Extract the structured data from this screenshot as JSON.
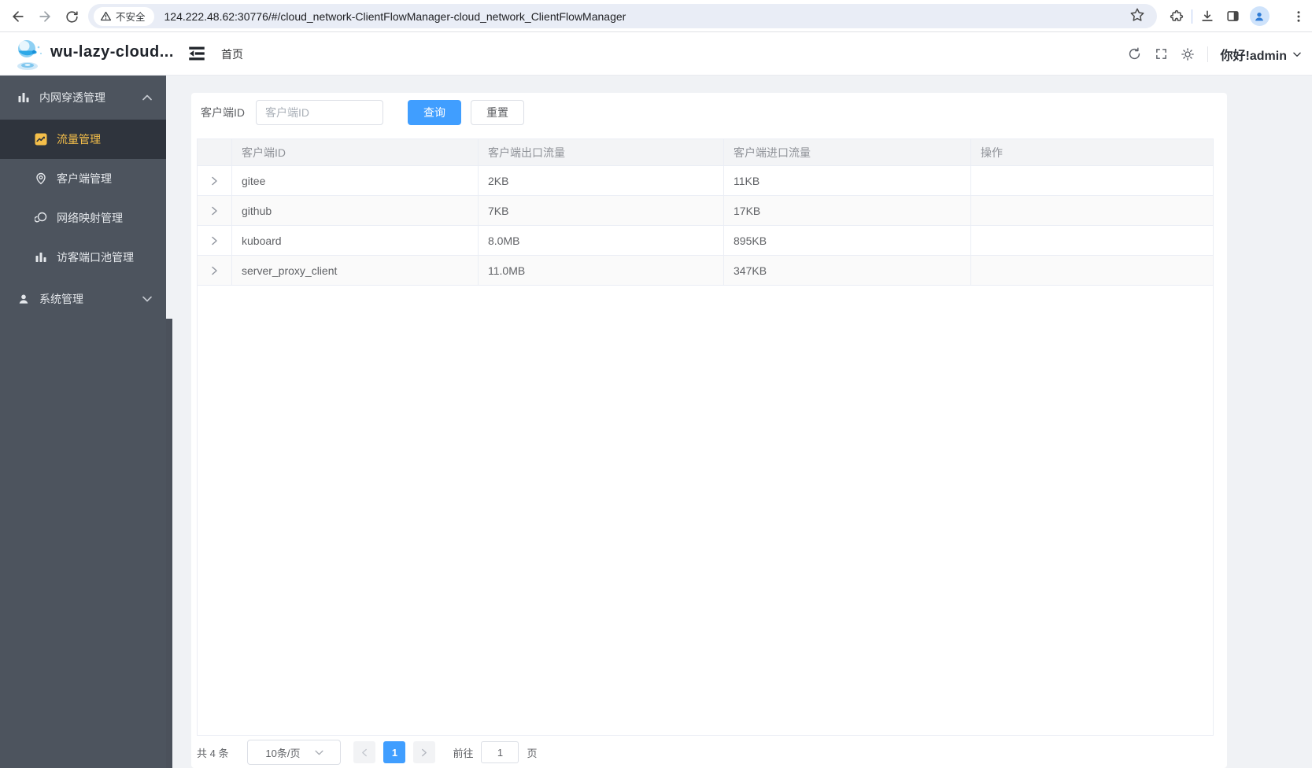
{
  "browser": {
    "security_label": "不安全",
    "url": "124.222.48.62:30776/#/cloud_network-ClientFlowManager-cloud_network_ClientFlowManager"
  },
  "header": {
    "app_title": "wu-lazy-cloud...",
    "nav_home": "首页",
    "greeting": "你好!admin"
  },
  "sidebar": {
    "items": [
      {
        "label": "内网穿透管理",
        "icon": "bar-chart-icon",
        "type": "group",
        "state": "expanded"
      },
      {
        "label": "流量管理",
        "icon": "trend-chart-icon",
        "type": "item",
        "active": true
      },
      {
        "label": "客户端管理",
        "icon": "location-pin-icon",
        "type": "item",
        "active": false
      },
      {
        "label": "网络映射管理",
        "icon": "network-mapping-icon",
        "type": "item",
        "active": false
      },
      {
        "label": "访客端口池管理",
        "icon": "bar-chart-icon",
        "type": "item",
        "active": false
      },
      {
        "label": "系统管理",
        "icon": "user-icon",
        "type": "group",
        "state": "collapsed"
      }
    ]
  },
  "filter": {
    "label": "客户端ID",
    "placeholder": "客户端ID",
    "query_label": "查询",
    "reset_label": "重置"
  },
  "table": {
    "columns": [
      "客户端ID",
      "客户端出口流量",
      "客户端进口流量",
      "操作"
    ],
    "rows": [
      {
        "id": "gitee",
        "out": "2KB",
        "in": "11KB"
      },
      {
        "id": "github",
        "out": "7KB",
        "in": "17KB"
      },
      {
        "id": "kuboard",
        "out": "8.0MB",
        "in": "895KB"
      },
      {
        "id": "server_proxy_client",
        "out": "11.0MB",
        "in": "347KB"
      }
    ]
  },
  "pagination": {
    "total_label": "共 4 条",
    "page_size_label": "10条/页",
    "current_page": "1",
    "goto_label": "前往",
    "goto_value": "1",
    "page_unit_label": "页"
  },
  "colors": {
    "accent_blue": "#409eff",
    "sidebar_bg": "#4d545e",
    "sidebar_active_bg": "#2f343d",
    "sidebar_active_text": "#f5bf4a",
    "page_bg": "#f0f2f5"
  }
}
